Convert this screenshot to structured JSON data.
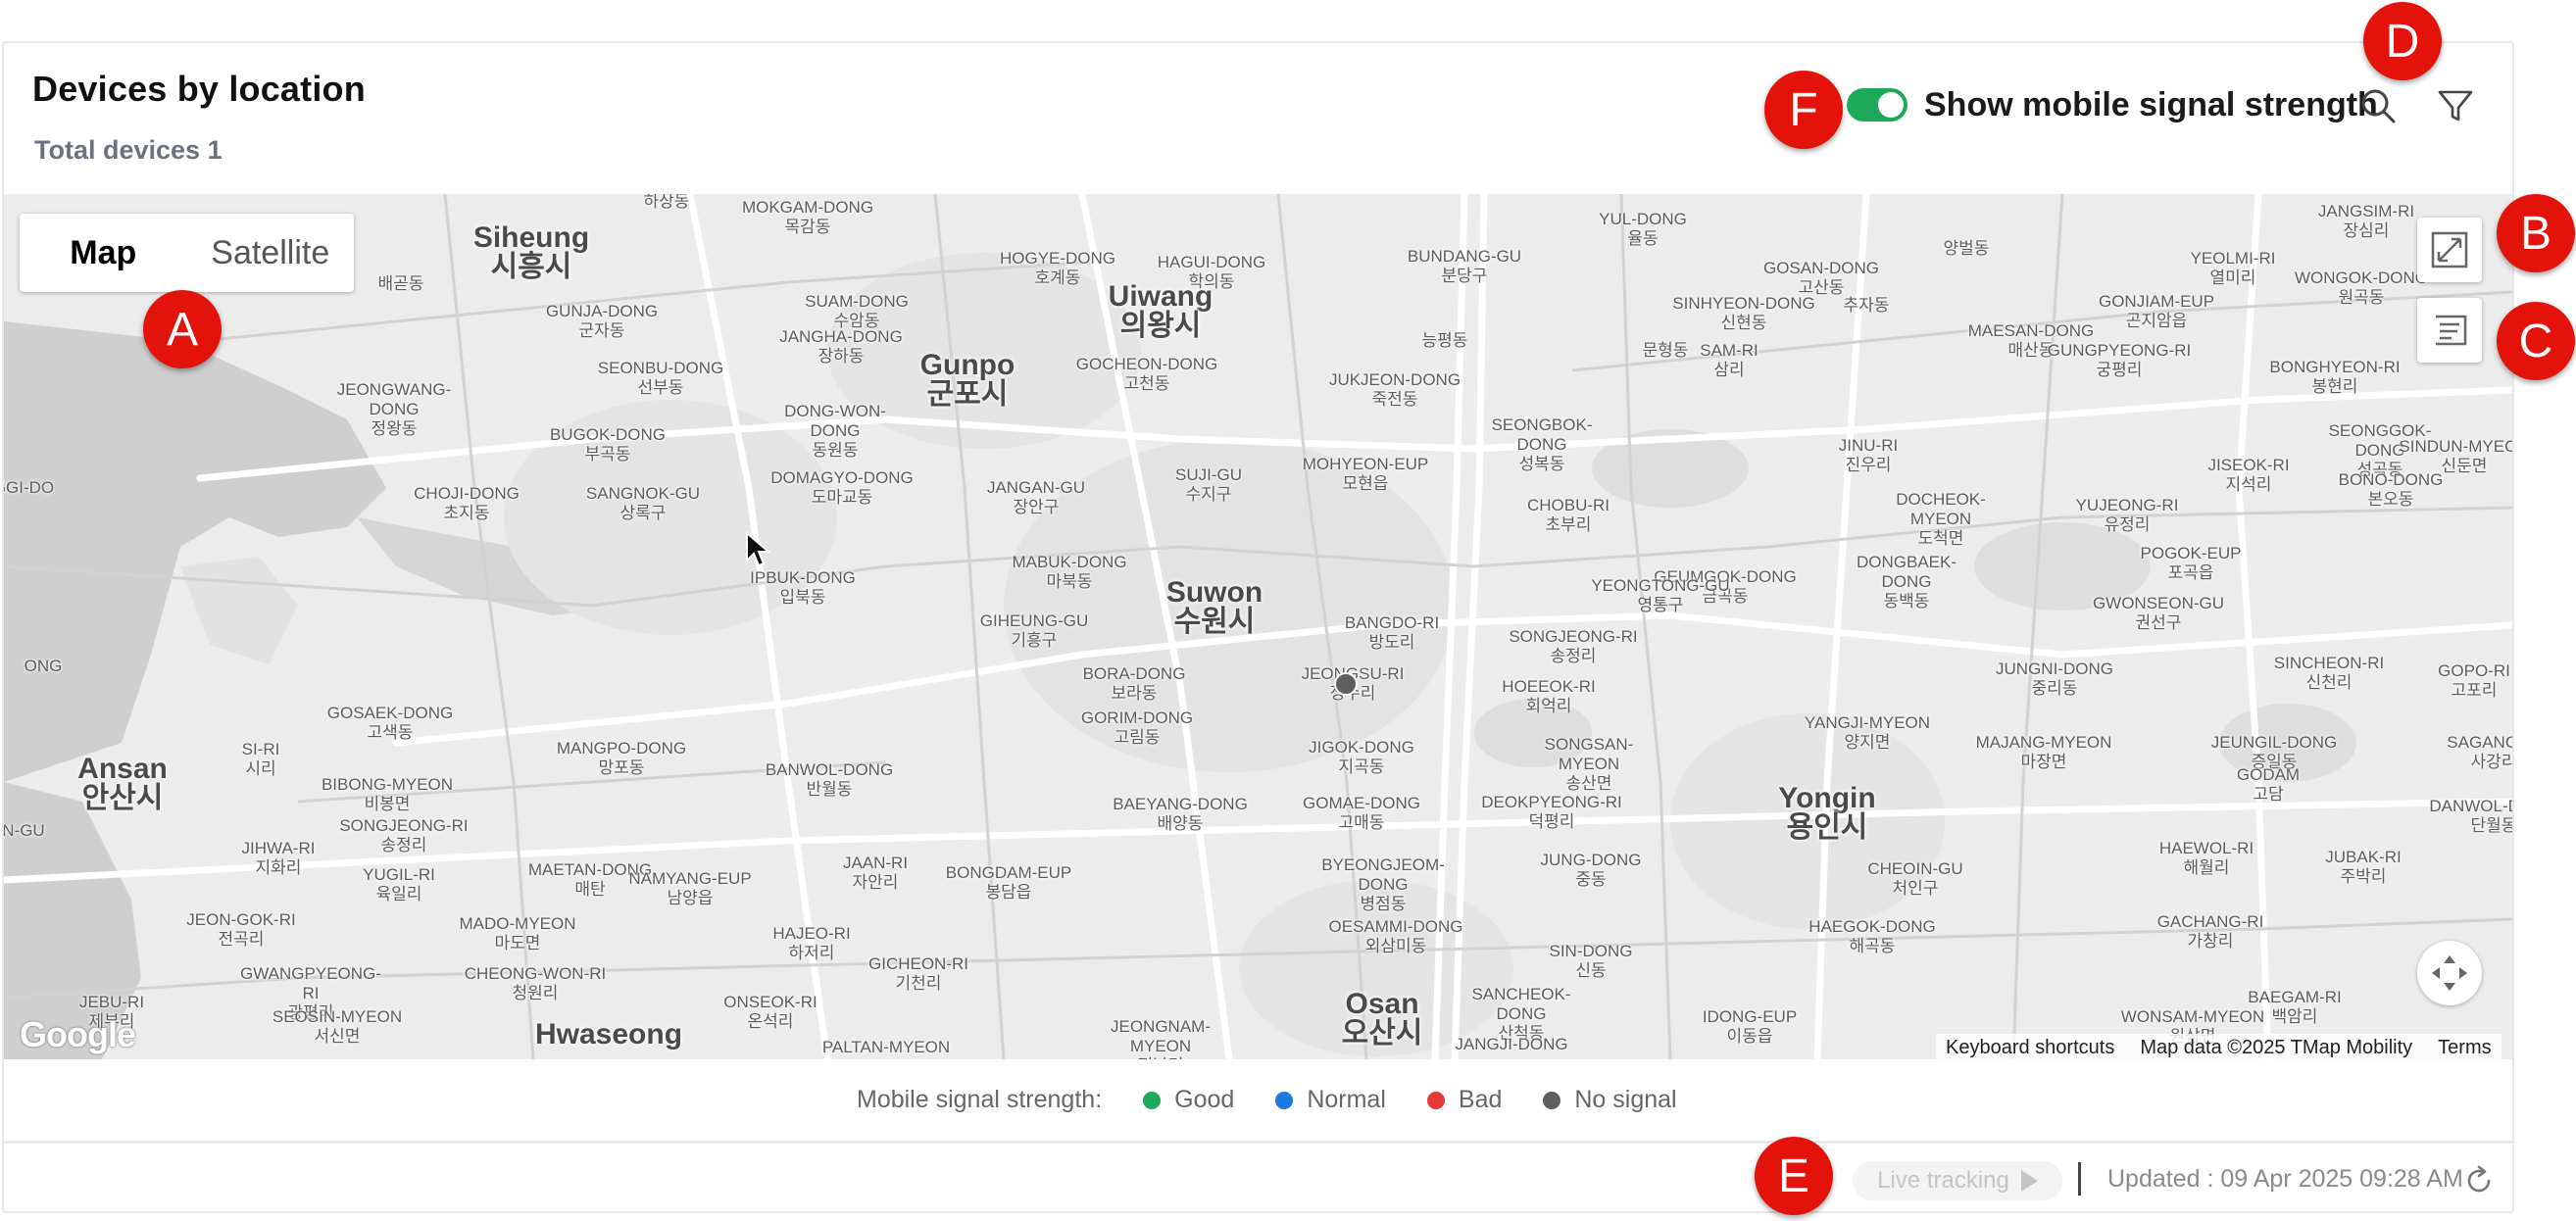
{
  "header": {
    "title": "Devices by location",
    "subtitle": "Total devices 1",
    "toggle_label": "Show mobile signal strength",
    "toggle_on": true,
    "search_icon": "search-icon",
    "filter_icon": "filter-icon"
  },
  "map": {
    "type_options": [
      "Map",
      "Satellite"
    ],
    "selected_type": "Map",
    "fullscreen_icon": "fullscreen-icon",
    "list_icon": "list-panel-icon",
    "recenter_icon": "recenter-icon",
    "google_logo": "Google",
    "attribution": {
      "shortcuts": "Keyboard shortcuts",
      "data": "Map data ©2025 TMap Mobility",
      "terms": "Terms"
    },
    "cities": [
      "Siheung\n시흥시",
      "Gunpo\n군포시",
      "Suwon\n수원시",
      "Ansan\n안산시",
      "Yongin\n용인시",
      "Osan\n오산시",
      "Uiwang\n의왕시",
      "Hwaseong"
    ],
    "labels": [
      "하상동",
      "MOKGAM-DONG\n목감동",
      "배곧동",
      "GUNJA-DONG\n군자동",
      "SUAM-DONG\n수암동",
      "HOGYE-DONG\n호계동",
      "HAGUI-DONG\n학의동",
      "BUNDANG-GU\n분당구",
      "YUL-DONG\n율동",
      "GOSAN-DONG\n고산동",
      "양벌동",
      "YEOLMI-RI\n열미리",
      "JANGSIM-RI\n장심리",
      "JEONGWANG-DONG\n정왕동",
      "SEONBU-DONG\n선부동",
      "JANGHA-DONG\n장하동",
      "GOCHEON-DONG\n고천동",
      "SINHYEON-DONG\n신현동",
      "추자동",
      "MAESAN-DONG\n매산동",
      "GONJIAM-EUP\n곤지암읍",
      "WONGOK-DONG\n원곡동",
      "BUGOK-DONG\n부곡동",
      "DONG-WON-DONG\n동원동",
      "능평동",
      "문형동",
      "SAM-RI\n삼리",
      "GUNGPYEONG-RI\n궁평리",
      "BONGHYEON-RI\n봉현리",
      "SEONGGOK-DONG\n성곡동",
      "CHOJI-DONG\n초지동",
      "SANGNOK-GU\n상록구",
      "DOMAGYO-DONG\n도마교동",
      "JANGAN-GU\n장안구",
      "SUJI-GU\n수지구",
      "JUKJEON-DONG\n죽전동",
      "SEONGBOK-DONG\n성복동",
      "MOHYEON-EUP\n모현읍",
      "JINU-RI\n진우리",
      "JISEOK-RI\n지석리",
      "SINDUN-MYEON\n신둔면",
      "BONO-DONG\n본오동",
      "IPBUK-DONG\n입북동",
      "MABUK-DONG\n마북동",
      "CHOBU-RI\n초부리",
      "DOCHEOK-MYEON\n도척면",
      "YUJEONG-RI\n유정리",
      "POGOK-EUP\n포곡읍",
      "DONGBAEK-DONG\n동백동",
      "GEUMGOK-DONG\n금곡동",
      "YEONGTONG-GU\n영통구",
      "GIHEUNG-GU\n기흥구",
      "BANGDO-RI\n방도리",
      "SONGJEONG-RI\n송정리",
      "GWONSEON-GU\n권선구",
      "MAETAN-DONG\n매탄",
      "BORA-DONG\n보라동",
      "JEONGSU-RI\n정수리",
      "HOEEOK-RI\n회억리",
      "JUNGNI-DONG\n중리동",
      "SINCHEON-RI\n신천리",
      "GOSAEK-DONG\n고색동",
      "GORIM-DONG\n고림동",
      "YANGJI-MYEON\n양지면",
      "MAJANG-MYEON\n마장면",
      "JEUNGIL-DONG\n증일동",
      "GOPO-RI\n고포리",
      "SI-RI\n시리",
      "MANGPO-DONG\n망포동",
      "JIGOK-DONG\n지곡동",
      "SONGSAN-MYEON\n송산면",
      "BIBONG-MYEON\n비봉면",
      "BANWOL-DONG\n반월동",
      "GOMAE-DONG\n고매동",
      "DEOKPYEONG-RI\n덕평리",
      "GODAM\n고담",
      "SAGANG-RI\n사강리",
      "SONGJEONG-RI\n송정리",
      "BAEYANG-DONG\n배양동",
      "DANWOL-DONG\n단월동",
      "JIHWA-RI\n지화리",
      "JAAN-RI\n자안리",
      "BYEONGJEOM-DONG\n병점동",
      "JUNG-DONG\n중동",
      "CHEOIN-GU\n처인구",
      "HAEWOL-RI\n해월리",
      "JUBAK-RI\n주박리",
      "YUGIL-RI\n육일리",
      "NAMYANG-EUP\n남양읍",
      "BONGDAM-EUP\n봉담읍",
      "JEON-GOK-RI\n전곡리",
      "MADO-MYEON\n마도면",
      "HAJEO-RI\n하저리",
      "OESAMMI-DONG\n외삼미동",
      "HAEGOK-DONG\n해곡동",
      "GACHANG-RI\n가창리",
      "GWANGPYEONG-RI\n광평리",
      "CHEONG-WON-RI\n청원리",
      "GICHEON-RI\n기천리",
      "SIN-DONG\n신동",
      "JEBU-RI\n제부리",
      "ONSEOK-RI\n온석리",
      "SANCHEOK-DONG\n산척동",
      "SEOSIN-MYEON\n서신면",
      "JEONGNAM-MYEON\n정남면",
      "IDONG-EUP\n이동읍",
      "BAEGAM-RI\n백암리",
      "WONSAM-MYEON\n원삼면",
      "PALTAN-MYEON",
      "JANGJI-DONG",
      "GGI-DO",
      "ONG",
      "N-GU"
    ]
  },
  "legend": {
    "label": "Mobile signal strength:",
    "items": [
      {
        "label": "Good",
        "color": "#1ea95a"
      },
      {
        "label": "Normal",
        "color": "#1f7ae0"
      },
      {
        "label": "Bad",
        "color": "#e53935"
      },
      {
        "label": "No signal",
        "color": "#5f5f5f"
      }
    ]
  },
  "footer": {
    "live_tracking_label": "Live tracking",
    "updated_text": "Updated : 09 Apr 2025 09:28 AM",
    "refresh_icon": "refresh-icon"
  },
  "callouts": [
    "A",
    "B",
    "C",
    "D",
    "E",
    "F"
  ],
  "colors": {
    "toggle_on": "#1ea95a",
    "callout": "#e3120b",
    "device_marker": "#5f5f5f"
  }
}
